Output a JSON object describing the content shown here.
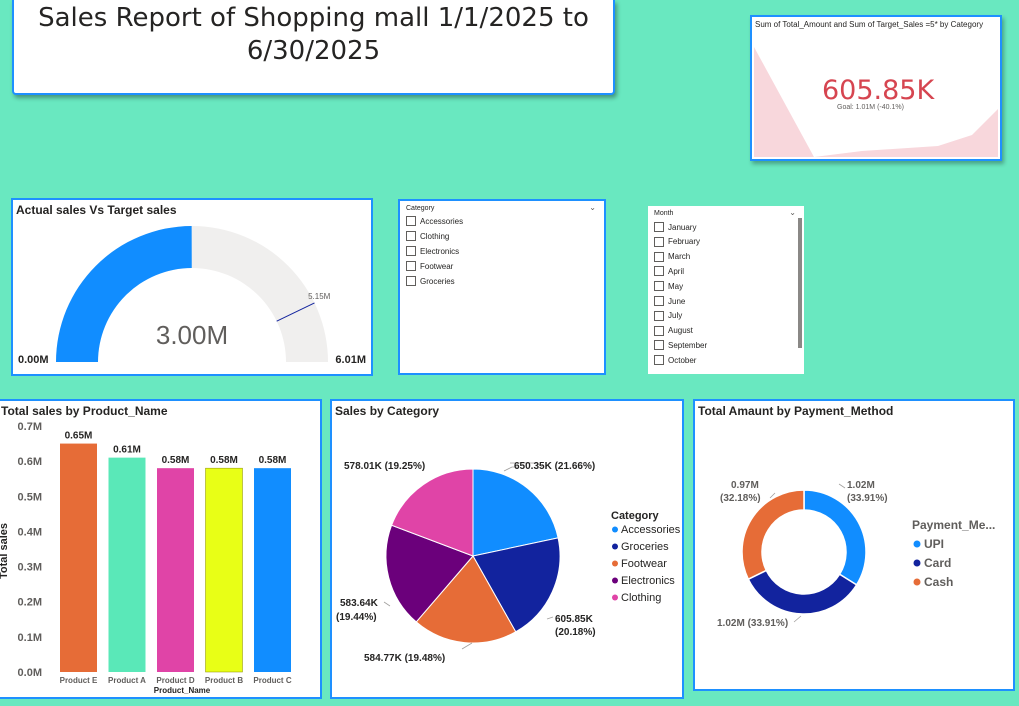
{
  "page_title": "Sales Report of Shopping mall 1/1/2025 to 6/30/2025",
  "kpi": {
    "title": "Sum of Total_Amount and Sum of Target_Sales =5* by Category",
    "value": "605.85K",
    "goal": "Goal: 1.01M (-40.1%)"
  },
  "gauge": {
    "title": "Actual sales Vs Target sales",
    "center_label": "3.00M",
    "min_label": "0.00M",
    "max_label": "6.01M",
    "target_label": "5.15M",
    "chart_data": {
      "type": "gauge",
      "value": 3.0,
      "min": 0,
      "max": 6.01,
      "target": 5.15,
      "unit": "M"
    }
  },
  "category_slicer": {
    "header": "Category",
    "items": [
      "Accessories",
      "Clothing",
      "Electronics",
      "Footwear",
      "Groceries"
    ]
  },
  "month_slicer": {
    "header": "Month",
    "items": [
      "January",
      "February",
      "March",
      "April",
      "May",
      "June",
      "July",
      "August",
      "September",
      "October"
    ]
  },
  "bar_chart": {
    "title": "Total sales by Product_Name",
    "chart_data": {
      "type": "bar",
      "categories": [
        "Product E",
        "Product A",
        "Product D",
        "Product B",
        "Product C"
      ],
      "values": [
        0.65,
        0.61,
        0.58,
        0.58,
        0.58
      ],
      "value_labels": [
        "0.65M",
        "0.61M",
        "0.58M",
        "0.58M",
        "0.58M"
      ],
      "colors": [
        "#e66c37",
        "#5ae8b8",
        "#e044a7",
        "#e8ff16",
        "#118dff"
      ],
      "xlabel": "Product_Name",
      "ylabel": "Total sales",
      "yticks": [
        "0.0M",
        "0.1M",
        "0.2M",
        "0.3M",
        "0.4M",
        "0.5M",
        "0.6M",
        "0.7M"
      ],
      "ylim": [
        0,
        0.7
      ]
    }
  },
  "pie_chart": {
    "title": "Sales by Category",
    "legend_title": "Category",
    "chart_data": {
      "type": "pie",
      "slices": [
        {
          "label": "Accessories",
          "value": 650.35,
          "text": "650.35K (21.66%)",
          "color": "#118dff"
        },
        {
          "label": "Groceries",
          "value": 605.85,
          "text": "605.85K (20.18%)",
          "color": "#12239e"
        },
        {
          "label": "Footwear",
          "value": 584.77,
          "text": "584.77K (19.48%)",
          "color": "#e66c37"
        },
        {
          "label": "Electronics",
          "value": 583.64,
          "text": "583.64K (19.44%)",
          "color": "#6b007b"
        },
        {
          "label": "Clothing",
          "value": 578.01,
          "text": "578.01K (19.25%)",
          "color": "#e044a7"
        }
      ]
    }
  },
  "donut_chart": {
    "title": "Total Amaunt by Payment_Method",
    "legend_title": "Payment_Me...",
    "chart_data": {
      "type": "pie",
      "slices": [
        {
          "label": "UPI",
          "value": 1.02,
          "text1": "1.02M",
          "text2": "(33.91%)",
          "color": "#118dff"
        },
        {
          "label": "Card",
          "value": 1.02,
          "text1": "1.02M (33.91%)",
          "text2": "",
          "color": "#12239e"
        },
        {
          "label": "Cash",
          "value": 0.97,
          "text1": "0.97M",
          "text2": "(32.18%)",
          "color": "#e66c37"
        }
      ]
    }
  }
}
